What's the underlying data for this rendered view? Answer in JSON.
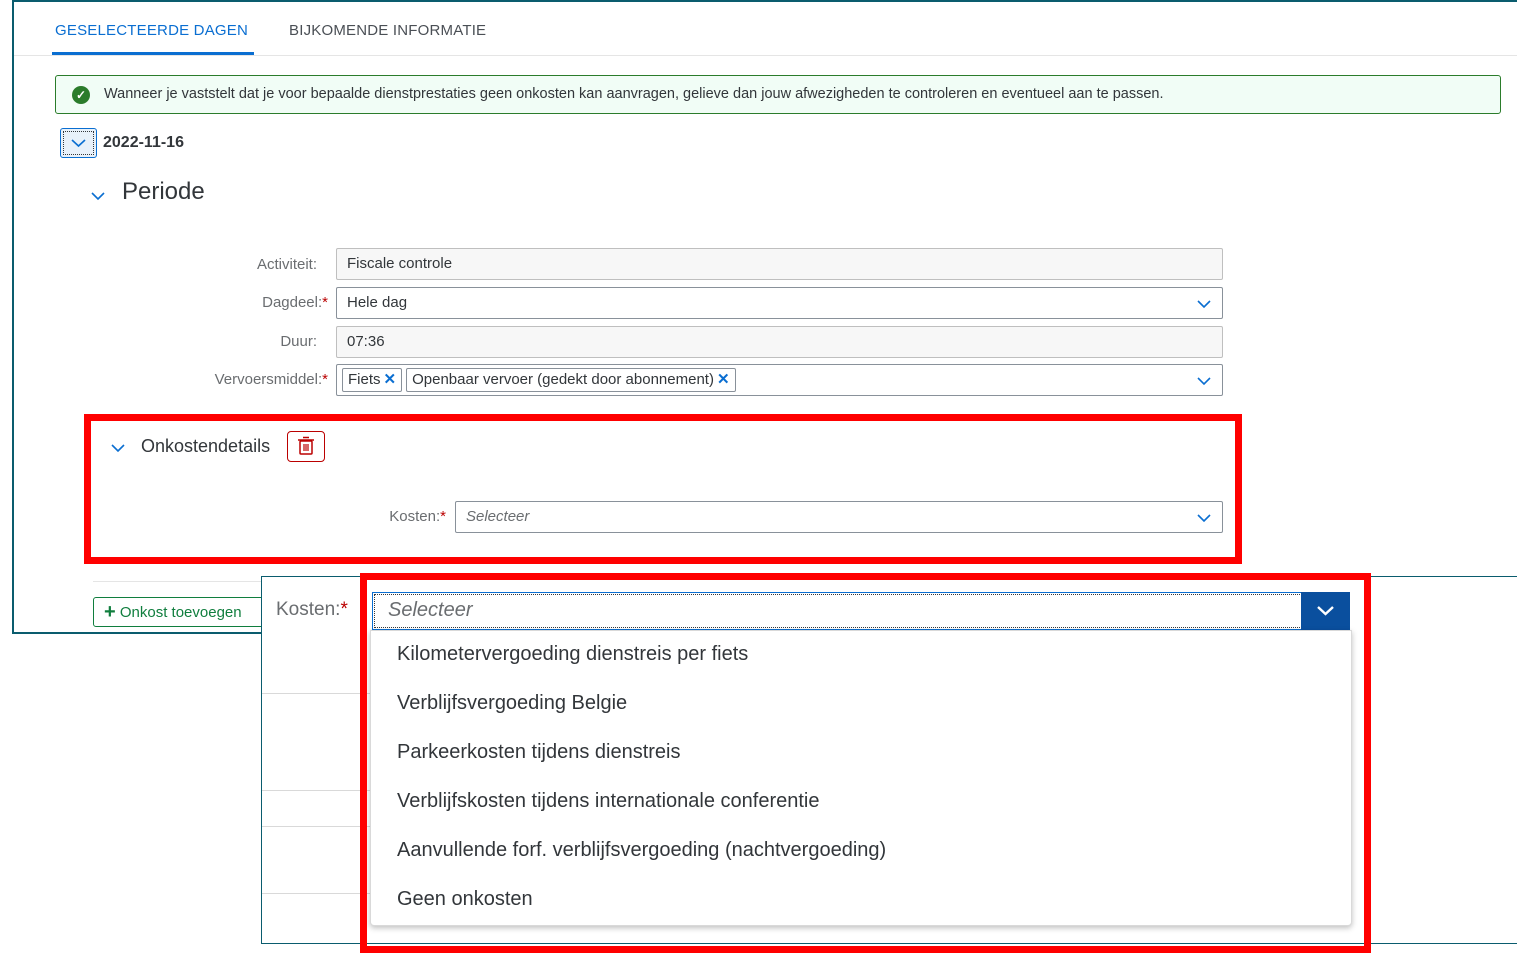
{
  "tabs": [
    {
      "label": "GESELECTEERDE DAGEN",
      "active": true
    },
    {
      "label": "BIJKOMENDE INFORMATIE",
      "active": false
    }
  ],
  "message": {
    "type": "success",
    "text": "Wanneer je vaststelt dat je voor bepaalde dienstprestaties geen onkosten kan aanvragen, gelieve dan jouw afwezigheden te controleren en eventueel aan te passen."
  },
  "day": {
    "date": "2022-11-16"
  },
  "periode": {
    "title": "Periode",
    "fields": {
      "activiteit": {
        "label": "Activiteit:",
        "value": "Fiscale controle"
      },
      "dagdeel": {
        "label": "Dagdeel:",
        "value": "Hele dag"
      },
      "duur": {
        "label": "Duur:",
        "value": "07:36"
      },
      "vervoersmiddel": {
        "label": "Vervoersmiddel:",
        "tokens": [
          "Fiets",
          "Openbaar vervoer (gedekt door abonnement)"
        ]
      }
    }
  },
  "onkosten": {
    "title": "Onkostendetails",
    "kosten_label": "Kosten:",
    "kosten_placeholder": "Selecteer"
  },
  "add_button": {
    "label": "Onkost toevoegen"
  },
  "zoom": {
    "kosten_label": "Kosten:",
    "placeholder": "Selecteer",
    "options": [
      "Kilometervergoeding dienstreis per fiets",
      "Verblijfsvergoeding Belgie",
      "Parkeerkosten tijdens dienstreis",
      "Verblijfskosten tijdens internationale conferentie",
      "Aanvullende forf. verblijfsvergoeding (nachtvergoeding)",
      "Geen onkosten"
    ]
  },
  "colors": {
    "accent": "#0a6ed1",
    "success": "#2b7c2b",
    "highlight": "#ff0000",
    "required": "#bb0000"
  }
}
